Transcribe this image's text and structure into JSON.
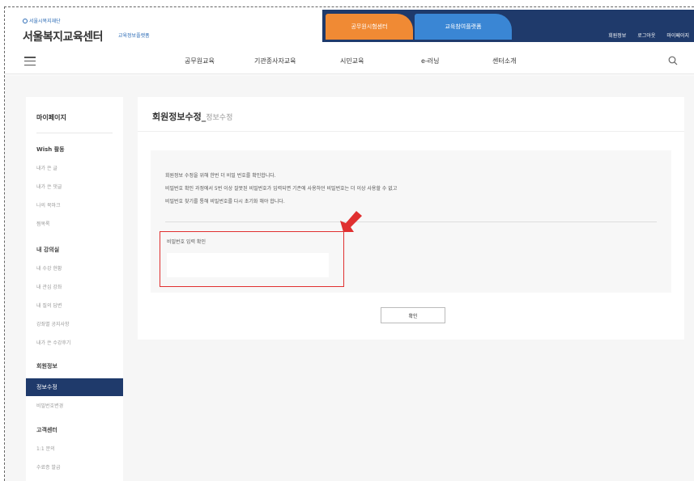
{
  "header": {
    "logo_small": "서울시복지재단",
    "logo_main": "서울복지교육센터",
    "logo_sub": "교육정보플랫폼",
    "tab_orange": "공무원시험센터",
    "tab_blue": "교육참여플랫폼",
    "util_links": [
      "회원정보",
      "로그아웃",
      "마이페이지"
    ]
  },
  "menu": [
    "공무원교육",
    "기관종사자교육",
    "시민교육",
    "e-러닝",
    "센터소개"
  ],
  "sidebar": {
    "title": "마이페이지",
    "sections": [
      {
        "head": "Wish 활동",
        "links": [
          "내가 쓴 글",
          "내가 쓴 댓글",
          "나의 북마크",
          "찜목록"
        ]
      },
      {
        "head": "내 강의실",
        "links": [
          "내 수강 현황",
          "내 관심 강좌",
          "내 질의 답변",
          "강좌별 공지사항",
          "내가 쓴 수강후기"
        ]
      },
      {
        "head": "회원정보",
        "active": "정보수정",
        "links": [
          "비밀번호변경"
        ]
      },
      {
        "head": "고객센터",
        "links": [
          "1:1 문의",
          "수료증 발급"
        ]
      }
    ]
  },
  "content": {
    "title": "회원정보수정",
    "subtitle": "정보수정",
    "notices": [
      "회원정보 수정을 위해 한번 더 비밀 번호를 확인합니다.",
      "비밀번호 확인 과정에서 5번 이상 잘못된 비밀번호가 입력되면 기존에 사용하던 비밀번호는 더 이상 사용할 수 없고",
      "비밀번호 찾기를 통해 비밀번호를 다시 초기화 해야 합니다."
    ],
    "pw_label": "비밀번호 입력 확인",
    "pw_value": "",
    "confirm_label": "확인"
  },
  "colors": {
    "navy": "#1f3a6b",
    "orange": "#f08a34",
    "blue": "#3a86d4",
    "highlight": "#e03030"
  }
}
